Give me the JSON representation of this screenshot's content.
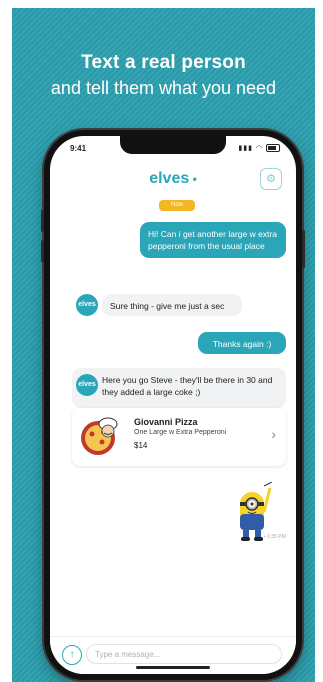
{
  "promo": {
    "headline": "Text a real person",
    "subline": "and tell them what you need"
  },
  "status_bar": {
    "time": "9:41"
  },
  "app": {
    "logo": "elves",
    "date_badge": "Now"
  },
  "messages": [
    {
      "from": "user",
      "text": "Hi! Can i get another large w extra pepperoni from the usual place"
    },
    {
      "from": "agent",
      "avatar": "elves",
      "text": "Sure thing - give me just a sec"
    },
    {
      "from": "user",
      "text": "Thanks again :)"
    },
    {
      "from": "agent",
      "avatar": "elves",
      "text": "Here you go Steve - they'll be there in 30 and they added a large coke ;)"
    }
  ],
  "order_card": {
    "title": "Giovanni Pizza",
    "subtitle": "One Large w Extra Pepperoni",
    "price": "$14"
  },
  "sticker_time": "• 1:35 PM",
  "composer": {
    "placeholder": "Type a message..."
  },
  "colors": {
    "brand": "#2aa6b8",
    "background": "#2b9faf",
    "badge": "#f2b722"
  },
  "icons": {
    "settings": "settings-icon",
    "attach": "attach-icon",
    "chevron": "chevron-right-icon"
  }
}
